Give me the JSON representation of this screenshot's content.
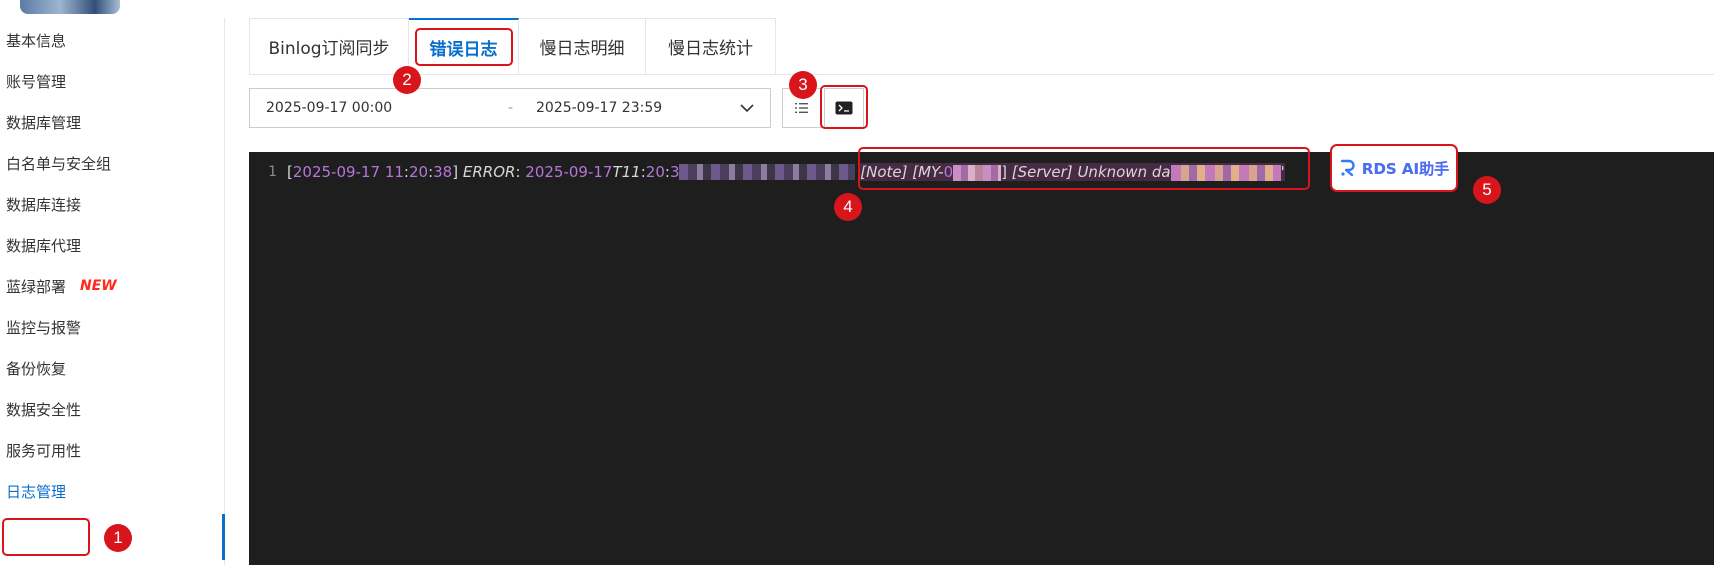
{
  "sidebar": {
    "items": [
      {
        "label": "基本信息"
      },
      {
        "label": "账号管理"
      },
      {
        "label": "数据库管理"
      },
      {
        "label": "白名单与安全组"
      },
      {
        "label": "数据库连接"
      },
      {
        "label": "数据库代理"
      },
      {
        "label": "蓝绿部署",
        "badge": "NEW"
      },
      {
        "label": "监控与报警"
      },
      {
        "label": "备份恢复"
      },
      {
        "label": "数据安全性"
      },
      {
        "label": "服务可用性"
      },
      {
        "label": "日志管理",
        "active": true
      }
    ]
  },
  "tabs": [
    {
      "label": "Binlog订阅同步"
    },
    {
      "label": "错误日志",
      "active": true
    },
    {
      "label": "慢日志明细"
    },
    {
      "label": "慢日志统计"
    }
  ],
  "daterange": {
    "start": "2025-09-17 00:00",
    "separator": "-",
    "end": "2025-09-17 23:59"
  },
  "log": {
    "line_number": "1",
    "bracket_open": "[",
    "date": "2025-09-17",
    "hour": "11",
    "colon1": ":",
    "minute": "20",
    "colon2": ":",
    "second": "38",
    "bracket_close": "]",
    "level": "ERROR",
    "level_colon": ":",
    "ts_date": "2025-09-17",
    "ts_t": "T11",
    "ts_colon": ":",
    "ts_min": "20",
    "ts_colon2": ":",
    "ts_sec_partial": "3",
    "note_tag": "[Note]",
    "my_tag_open": "[MY-",
    "my_tag_partial": "0",
    "my_tag_close": "]",
    "server_tag": "[Server]",
    "message_partial": "Unknown da",
    "trailing": "'"
  },
  "ai_button": {
    "label": "RDS AI助手",
    "icon": "rds-logo-icon"
  },
  "annotations": [
    "1",
    "2",
    "3",
    "4",
    "5"
  ],
  "colors": {
    "accent": "#0a6fcc",
    "annotation_red": "#d7151b",
    "log_bg": "#1e1e1e",
    "log_purple": "#b576d8",
    "new_badge": "#ff2a1a"
  }
}
